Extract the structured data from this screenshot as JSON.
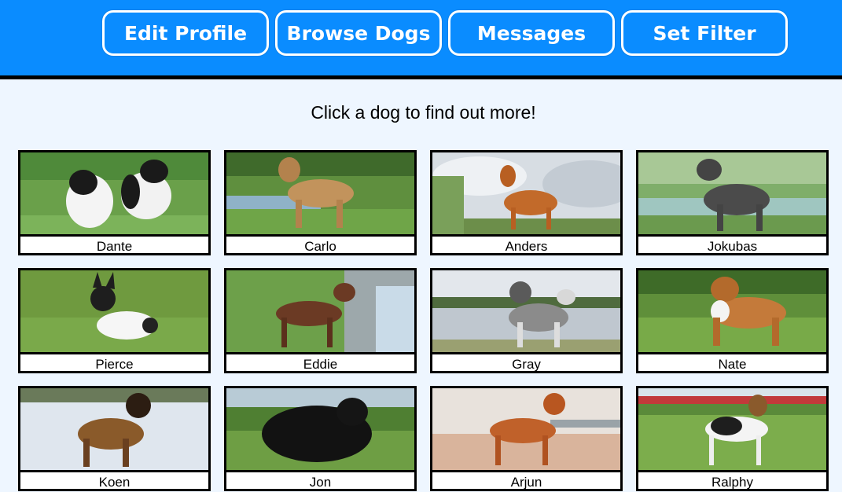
{
  "nav": {
    "edit_profile": "Edit Profile",
    "browse_dogs": "Browse Dogs",
    "messages": "Messages",
    "set_filter": "Set Filter"
  },
  "prompt": "Click a dog to find out more!",
  "colors": {
    "header_bg": "#0a8cff",
    "page_bg": "#eef6ff",
    "button_border": "#ffffff"
  },
  "dogs": [
    {
      "name": "Dante"
    },
    {
      "name": "Carlo"
    },
    {
      "name": "Anders"
    },
    {
      "name": "Jokubas"
    },
    {
      "name": "Pierce"
    },
    {
      "name": "Eddie"
    },
    {
      "name": "Gray"
    },
    {
      "name": "Nate"
    },
    {
      "name": "Koen"
    },
    {
      "name": "Jon"
    },
    {
      "name": "Arjun"
    },
    {
      "name": "Ralphy"
    }
  ]
}
